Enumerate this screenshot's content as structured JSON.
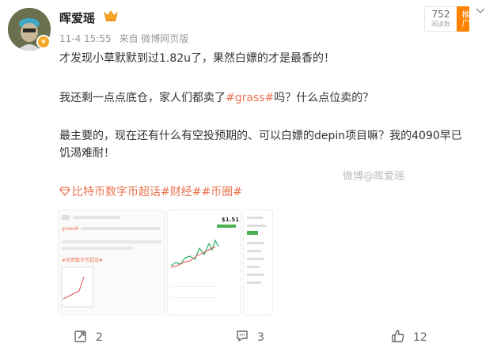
{
  "post": {
    "author": "晖爱瑶",
    "author_badge": "v",
    "time": "11-4 15:55",
    "from": "来自 微博网页版",
    "views_count": "752",
    "views_label": "阅读数",
    "push_label": "推广",
    "paragraphs": [
      [
        "才发现小草默默到过1.82u了，果然白嫖的才是最香的！"
      ],
      [
        "我还剩一点点底仓，家人们都卖了",
        "#grass#",
        "吗？什么点位卖的？"
      ],
      [
        "最主要的，现在还有什么有空投预期的、可以白嫖的depin项目嘛？我的4090早已"
      ],
      [
        "饥渴难耐！"
      ]
    ],
    "watermark": "微博@晖爱瑶",
    "topics": "比特币数字币超话#财经##币圈#"
  },
  "images": [
    {
      "tag": "grass#",
      "link": "#加密数字币超话#"
    },
    {
      "price": "$1.51"
    },
    {}
  ],
  "actions": {
    "repost": "2",
    "comment": "3",
    "like": "12"
  },
  "colors": {
    "accent": "#eb7350",
    "push": "#ff8200",
    "text": "#333333",
    "meta": "#999999"
  }
}
